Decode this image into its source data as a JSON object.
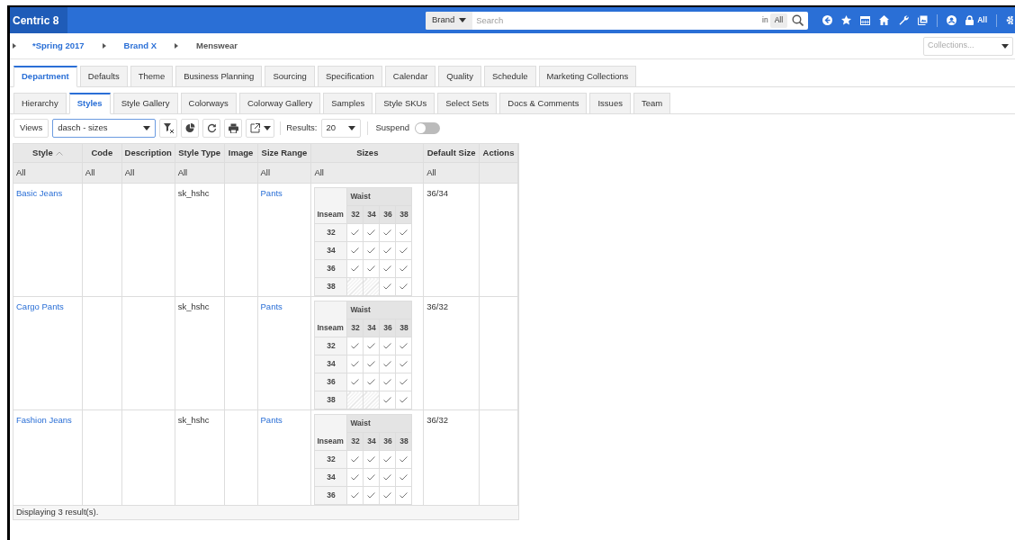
{
  "app": {
    "logo": "Centric 8",
    "search": {
      "scope": "Brand",
      "placeholder": "Search",
      "in_label": "in",
      "in_value": "All"
    },
    "lock_label": "All"
  },
  "breadcrumb": [
    {
      "label": "*Spring 2017",
      "link": true
    },
    {
      "label": "Brand X",
      "link": true
    },
    {
      "label": "Menswear",
      "link": false
    }
  ],
  "collections": {
    "placeholder": "Collections..."
  },
  "tabs": [
    {
      "label": "Department",
      "selected": true
    },
    {
      "label": "Defaults",
      "selected": false
    },
    {
      "label": "Theme",
      "selected": false
    },
    {
      "label": "Business Planning",
      "selected": false
    },
    {
      "label": "Sourcing",
      "selected": false
    },
    {
      "label": "Specification",
      "selected": false
    },
    {
      "label": "Calendar",
      "selected": false
    },
    {
      "label": "Quality",
      "selected": false
    },
    {
      "label": "Schedule",
      "selected": false
    },
    {
      "label": "Marketing Collections",
      "selected": false
    }
  ],
  "subtabs": [
    {
      "label": "Hierarchy",
      "selected": false
    },
    {
      "label": "Styles",
      "selected": true
    },
    {
      "label": "Style Gallery",
      "selected": false
    },
    {
      "label": "Colorways",
      "selected": false
    },
    {
      "label": "Colorway Gallery",
      "selected": false
    },
    {
      "label": "Samples",
      "selected": false
    },
    {
      "label": "Style SKUs",
      "selected": false
    },
    {
      "label": "Select Sets",
      "selected": false
    },
    {
      "label": "Docs & Comments",
      "selected": false
    },
    {
      "label": "Issues",
      "selected": false
    },
    {
      "label": "Team",
      "selected": false
    }
  ],
  "toolbar": {
    "views_label": "Views",
    "view": "dasch - sizes",
    "results_label": "Results:",
    "results": "20",
    "suspend": {
      "label": "Suspend",
      "on": false
    }
  },
  "table": {
    "columns": [
      {
        "label": "Style",
        "sorted": true,
        "filter": "All"
      },
      {
        "label": "Code",
        "sorted": false,
        "filter": "All"
      },
      {
        "label": "Description",
        "sorted": false,
        "filter": "All"
      },
      {
        "label": "Style Type",
        "sorted": false,
        "filter": "All"
      },
      {
        "label": "Image",
        "sorted": false
      },
      {
        "label": "Size Range",
        "sorted": false,
        "filter": "All"
      },
      {
        "label": "Sizes",
        "sorted": false,
        "filter": "All"
      },
      {
        "label": "Default Size",
        "sorted": false,
        "filter": "All"
      },
      {
        "label": "Actions",
        "sorted": false
      }
    ],
    "rows": [
      {
        "style": "Basic Jeans",
        "style_type": "sk_hshc",
        "size_range": "Pants",
        "default_size": "36/34",
        "sizes": {
          "col_header": "Waist",
          "row_header": "Inseam",
          "columns": [
            "32",
            "34",
            "36",
            "38"
          ],
          "rows": [
            {
              "label": "32",
              "cells": [
                {
                  "available": true
                },
                {
                  "available": true
                },
                {
                  "available": true
                },
                {
                  "available": true
                }
              ]
            },
            {
              "label": "34",
              "cells": [
                {
                  "available": true
                },
                {
                  "available": true
                },
                {
                  "available": true
                },
                {
                  "available": true
                }
              ]
            },
            {
              "label": "36",
              "cells": [
                {
                  "available": true
                },
                {
                  "available": true
                },
                {
                  "available": true
                },
                {
                  "available": true
                }
              ]
            },
            {
              "label": "38",
              "cells": [
                {
                  "available": false
                },
                {
                  "available": false
                },
                {
                  "available": true
                },
                {
                  "available": true
                }
              ]
            }
          ]
        }
      },
      {
        "style": "Cargo Pants",
        "style_type": "sk_hshc",
        "size_range": "Pants",
        "default_size": "36/32",
        "sizes": {
          "col_header": "Waist",
          "row_header": "Inseam",
          "columns": [
            "32",
            "34",
            "36",
            "38"
          ],
          "rows": [
            {
              "label": "32",
              "cells": [
                {
                  "available": true
                },
                {
                  "available": true
                },
                {
                  "available": true
                },
                {
                  "available": true
                }
              ]
            },
            {
              "label": "34",
              "cells": [
                {
                  "available": true
                },
                {
                  "available": true
                },
                {
                  "available": true
                },
                {
                  "available": true
                }
              ]
            },
            {
              "label": "36",
              "cells": [
                {
                  "available": true
                },
                {
                  "available": true
                },
                {
                  "available": true
                },
                {
                  "available": true
                }
              ]
            },
            {
              "label": "38",
              "cells": [
                {
                  "available": false
                },
                {
                  "available": false
                },
                {
                  "available": true
                },
                {
                  "available": true
                }
              ]
            }
          ]
        }
      },
      {
        "style": "Fashion Jeans",
        "style_type": "sk_hshc",
        "size_range": "Pants",
        "default_size": "36/32",
        "sizes": {
          "col_header": "Waist",
          "row_header": "Inseam",
          "columns": [
            "32",
            "34",
            "36",
            "38"
          ],
          "rows": [
            {
              "label": "32",
              "cells": [
                {
                  "available": true
                },
                {
                  "available": true
                },
                {
                  "available": true
                },
                {
                  "available": true
                }
              ]
            },
            {
              "label": "34",
              "cells": [
                {
                  "available": true
                },
                {
                  "available": true
                },
                {
                  "available": true
                },
                {
                  "available": true
                }
              ]
            },
            {
              "label": "36",
              "cells": [
                {
                  "available": true
                },
                {
                  "available": true
                },
                {
                  "available": true
                },
                {
                  "available": true
                }
              ]
            }
          ]
        }
      }
    ]
  },
  "footer": "Displaying 3 result(s)."
}
